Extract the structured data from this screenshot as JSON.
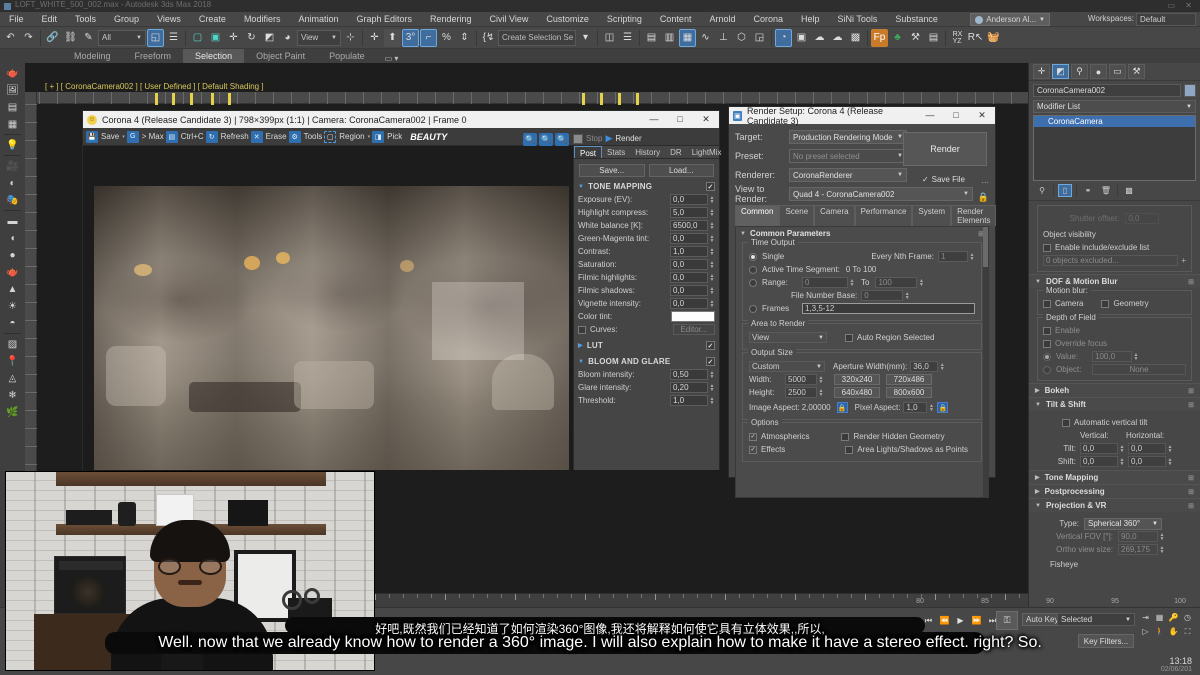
{
  "window": {
    "title": "LOFT_WHITE_500_002.max - Autodesk 3ds Max 2018",
    "minimize": "—",
    "maximize": "□",
    "close": "✕"
  },
  "menu": {
    "items": [
      "File",
      "Edit",
      "Tools",
      "Group",
      "Views",
      "Create",
      "Modifiers",
      "Animation",
      "Graph Editors",
      "Rendering",
      "Civil View",
      "Customize",
      "Scripting",
      "Content",
      "Arnold",
      "Corona",
      "Help",
      "SiNi Tools",
      "Substance"
    ],
    "user": "Anderson Al...",
    "workspaces_label": "Workspaces:",
    "workspace_value": "Default"
  },
  "toolbar": {
    "undo": "↶",
    "redo": "↷",
    "selection_filter": "All",
    "reference_coord": "View",
    "selection_set_placeholder": "Create Selection Se",
    "icons": [
      "link-icon",
      "unlink-icon",
      "bind-space-warp-icon",
      "select-object-icon",
      "select-by-name-icon",
      "rect-select-icon",
      "window-crossing-icon",
      "move-icon",
      "rotate-icon",
      "scale-icon",
      "snap-toggle-icon",
      "angle-snap-icon",
      "percent-snap-icon",
      "spinner-snap-icon",
      "mirror-icon",
      "align-icon",
      "layer-manager-icon",
      "curve-editor-icon",
      "schematic-view-icon",
      "material-editor-icon",
      "render-setup-icon",
      "render-frame-icon",
      "render-production-icon",
      "render-iterative-icon",
      "quad-render-icon",
      "fp-icon",
      "cloth-icon",
      "utilities-icon",
      "scene-explorer-icon"
    ]
  },
  "ribbon": {
    "tabs": [
      "Modeling",
      "Freeform",
      "Selection",
      "Object Paint",
      "Populate"
    ],
    "active_tab": "Selection"
  },
  "viewport": {
    "label": "[ + ] [ CoronaCamera002 ] [ User Defined ] [ Default Shading ]"
  },
  "vfb": {
    "title": "Corona 4 (Release Candidate 3) | 798×399px (1:1) | Camera: CoronaCamera002 | Frame 0",
    "minimize": "—",
    "maximize": "□",
    "close": "✕",
    "toolbar": [
      "Save",
      "> Max",
      "Ctrl+C",
      "Refresh",
      "Erase",
      "Tools",
      "Region",
      "Pick"
    ],
    "mode_label": "BEAUTY",
    "stop_label": "Stop",
    "render_label": "Render",
    "tabs": [
      "Post",
      "Stats",
      "History",
      "DR",
      "LightMix"
    ],
    "active_tab": "Post",
    "save_button": "Save...",
    "load_button": "Load...",
    "tone_mapping": {
      "header": "TONE MAPPING",
      "enabled": "✓",
      "rows": [
        {
          "label": "Exposure (EV):",
          "value": "0,0"
        },
        {
          "label": "Highlight compress:",
          "value": "5,0"
        },
        {
          "label": "White balance [K]:",
          "value": "6500,0"
        },
        {
          "label": "Green-Magenta tint:",
          "value": "0,0"
        },
        {
          "label": "Contrast:",
          "value": "1,0"
        },
        {
          "label": "Saturation:",
          "value": "0,0"
        },
        {
          "label": "Filmic highlights:",
          "value": "0,0"
        },
        {
          "label": "Filmic shadows:",
          "value": "0,0"
        },
        {
          "label": "Vignette intensity:",
          "value": "0,0"
        }
      ],
      "color_tint_label": "Color tint:",
      "color_tint_hex": "#FFFFFF",
      "curves_label": "Curves:",
      "curves_editor": "Editor..."
    },
    "lut": {
      "header": "LUT",
      "enabled": "✓"
    },
    "bloom": {
      "header": "BLOOM AND GLARE",
      "enabled": "✓",
      "rows": [
        {
          "label": "Bloom intensity:",
          "value": "0,50"
        },
        {
          "label": "Glare intensity:",
          "value": "0,20"
        },
        {
          "label": "Threshold:",
          "value": "1,0"
        }
      ]
    }
  },
  "render_setup": {
    "title": "Render Setup: Corona 4 (Release Candidate 3)",
    "minimize": "—",
    "maximize": "□",
    "close": "✕",
    "target_label": "Target:",
    "target_value": "Production Rendering Mode",
    "preset_label": "Preset:",
    "preset_value": "No preset selected",
    "renderer_label": "Renderer:",
    "renderer_value": "CoronaRenderer",
    "view_label": "View to Render:",
    "view_value": "Quad 4 - CoronaCamera002",
    "render_button": "Render",
    "save_file_label": "Save File",
    "more_dots": "...",
    "lock_icon": "🔒",
    "tabs": [
      "Common",
      "Scene",
      "Camera",
      "Performance",
      "System",
      "Render Elements"
    ],
    "active_tab": "Common",
    "rollout": "Common Parameters",
    "time_output": {
      "group": "Time Output",
      "single": "Single",
      "every_nth_label": "Every Nth Frame:",
      "every_nth_value": "1",
      "active_segment": "Active Time Segment:",
      "active_segment_value": "0 To 100",
      "range": "Range:",
      "range_from": "0",
      "range_to_label": "To",
      "range_to": "100",
      "file_number_label": "File Number Base:",
      "file_number_value": "0",
      "frames": "Frames",
      "frames_value": "1,3,5-12"
    },
    "area_to_render": {
      "group": "Area to Render",
      "value": "View",
      "auto_region": "Auto Region Selected"
    },
    "output_size": {
      "group": "Output Size",
      "preset": "Custom",
      "aperture_label": "Aperture Width(mm):",
      "aperture_value": "36,0",
      "width_label": "Width:",
      "width_value": "5000",
      "height_label": "Height:",
      "height_value": "2500",
      "presets": [
        "320x240",
        "720x486",
        "640x480",
        "800x600"
      ],
      "image_aspect_label": "Image Aspect:",
      "image_aspect_value": "2,00000",
      "pixel_aspect_label": "Pixel Aspect:",
      "pixel_aspect_value": "1,0"
    },
    "options": {
      "group": "Options",
      "atmospherics": "Atmospherics",
      "effects": "Effects",
      "render_hidden": "Render Hidden Geometry",
      "area_lights": "Area Lights/Shadows as Points"
    }
  },
  "command_panel": {
    "tabs": [
      "create-icon",
      "modify-icon",
      "hierarchy-icon",
      "motion-icon",
      "display-icon",
      "utilities-icon"
    ],
    "active_tab_index": 1,
    "object_name": "CoronaCamera002",
    "modifier_list": "Modifier List",
    "stack_item": "CoronaCamera",
    "stack_buttons": [
      "pin-stack-icon",
      "show-end-result-icon",
      "make-unique-icon",
      "remove-modifier-icon",
      "configure-sets-icon"
    ],
    "shutter_offset_label": "Shutter offset:",
    "shutter_offset_value": "0,0",
    "object_visibility_group": "Object visibility",
    "enable_include_exclude": "Enable include/exclude list",
    "excluded_value": "0 objects excluded...",
    "excluded_plus": "+",
    "dof_header": "DOF & Motion Blur",
    "motion_blur_group": "Motion blur:",
    "motion_blur_camera": "Camera",
    "motion_blur_geometry": "Geometry",
    "dof_group": "Depth of Field",
    "dof_enable": "Enable",
    "dof_override": "Override focus",
    "dof_value_label": "Value:",
    "dof_value": "100,0",
    "dof_object_label": "Object:",
    "dof_object_value": "None",
    "bokeh_header": "Bokeh",
    "tilt_shift_header": "Tilt & Shift",
    "auto_vertical_tilt": "Automatic vertical tilt",
    "vertical_col": "Vertical:",
    "horizontal_col": "Horizontal:",
    "tilt_label": "Tilt:",
    "tilt_v": "0,0",
    "tilt_h": "0,0",
    "shift_label": "Shift:",
    "shift_v": "0,0",
    "shift_h": "0,0",
    "tone_mapping_header": "Tone Mapping",
    "postprocessing_header": "Postprocessing",
    "projection_header": "Projection & VR",
    "type_label": "Type:",
    "type_value": "Spherical 360°",
    "vertical_fov_label": "Vertical FOV [°]:",
    "vertical_fov_value": "90,0",
    "ortho_label": "Ortho view size:",
    "ortho_value": "269,175",
    "fisheye_label": "Fisheye"
  },
  "timeline": {
    "ticks": [
      "80",
      "85",
      "90",
      "95",
      "100"
    ]
  },
  "status": {
    "transport": [
      "⏮",
      "⏪",
      "▶",
      "⏩",
      "⏭"
    ],
    "key_mode_icon": "set-key-icon",
    "auto_key": "Auto Key",
    "selection_level": "Selected",
    "key_filters": "Key Filters...",
    "time": "13:18",
    "date": "02/06/201"
  },
  "subtitles": {
    "chinese": "好吧,既然我们已经知道了如何渲染360°图像,我还将解释如何使它具有立体效果,,所以,",
    "english": "Well. now that we already know how to render a 360° image. I will also explain how to make it have a stereo effect. right? So."
  },
  "colors": {
    "accent_blue": "#3f6d9e",
    "panel_bg": "#474747",
    "window_chrome": "#f0f0f0",
    "viewport_bg": "#1d1d1d",
    "highlight": "#6fa8dc"
  }
}
